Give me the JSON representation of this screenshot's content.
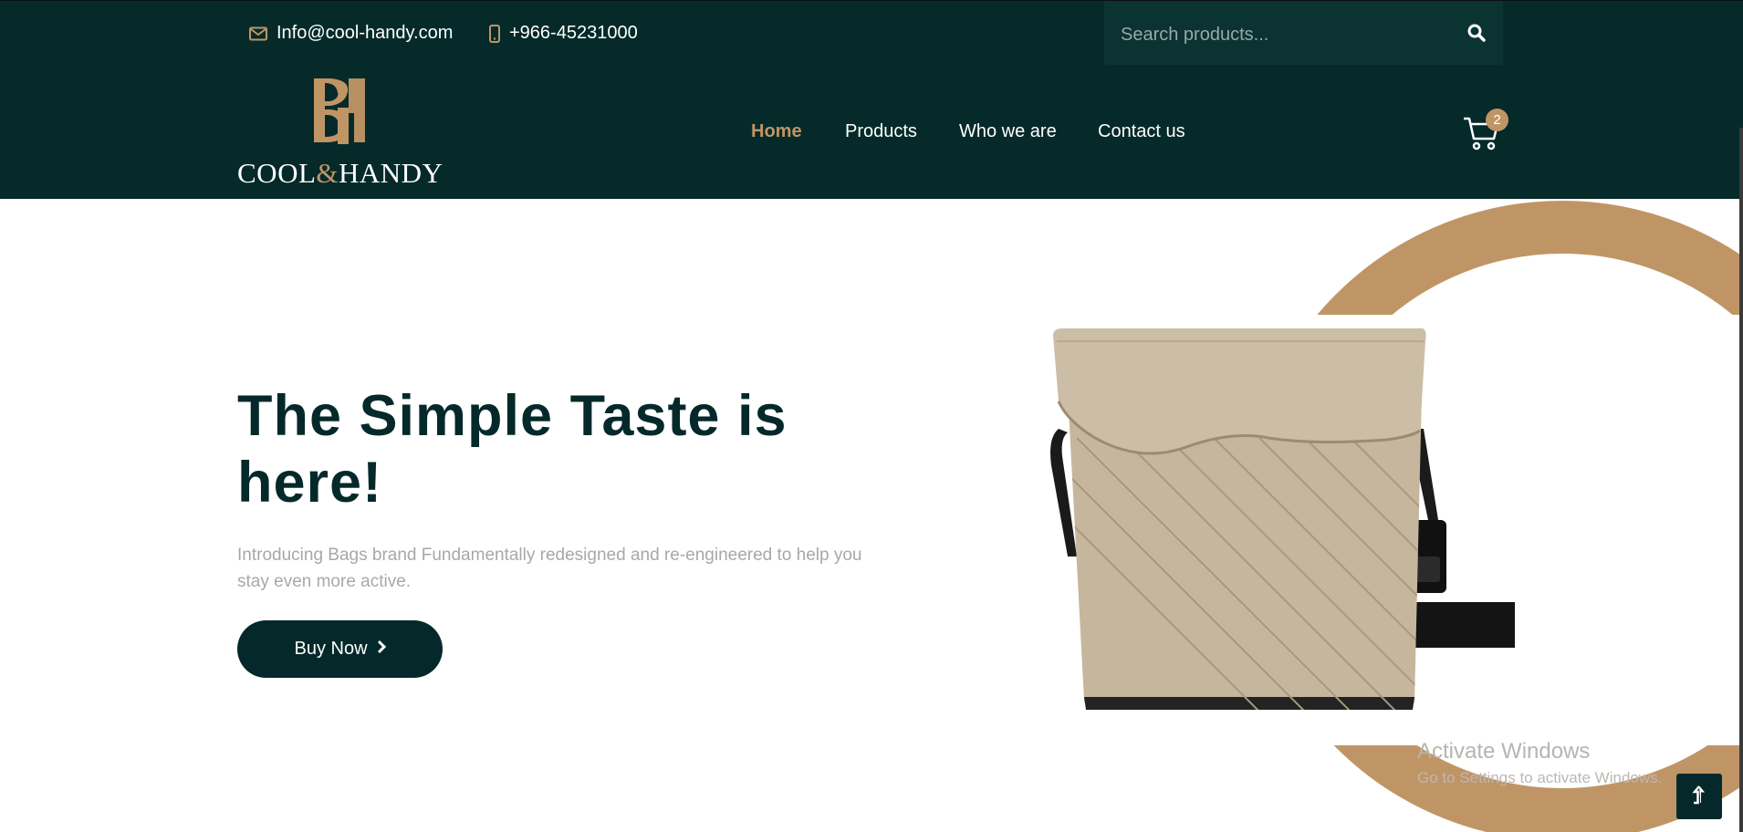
{
  "topbar": {
    "email": "Info@cool-handy.com",
    "phone": "+966-45231000",
    "search_placeholder": "Search products..."
  },
  "brand": {
    "name_left": "COOL",
    "name_amp": "&",
    "name_right": "HANDY"
  },
  "nav": {
    "items": [
      "Home",
      "Products",
      "Who we are",
      "Contact us"
    ],
    "active": "Home"
  },
  "cart": {
    "count": "2"
  },
  "hero": {
    "title": "The Simple Taste is here!",
    "description": "Introducing Bags brand Fundamentally redesigned and re-engineered to help you stay even more active.",
    "button_label": "Buy Now"
  },
  "watermark": {
    "line1": "Activate Windows",
    "line2": "Go to Settings to activate Windows."
  },
  "colors": {
    "dark_green": "#052a29",
    "gold": "#c09566",
    "text_grey": "#a8a8a8"
  },
  "icons": [
    "envelope-icon",
    "mobile-phone-icon",
    "search-icon",
    "cart-icon",
    "chevron-right-icon",
    "arrow-up-icon"
  ]
}
